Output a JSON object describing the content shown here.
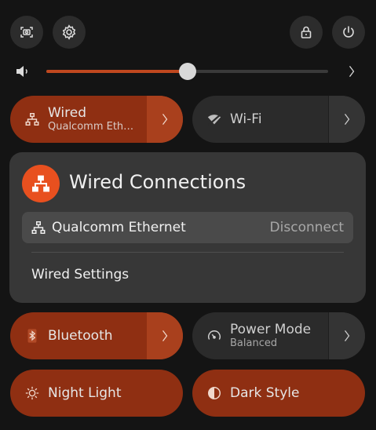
{
  "top_bar": {
    "screenshot_icon": "screenshot-icon",
    "settings_icon": "settings-gear-icon",
    "lock_icon": "lock-icon",
    "power_icon": "power-icon"
  },
  "volume": {
    "level": 0.5,
    "icon": "speaker-icon",
    "arrow": "chevron-right-icon"
  },
  "toggles": {
    "wired": {
      "title": "Wired",
      "subtitle": "Qualcomm Eth…",
      "active": true
    },
    "wifi": {
      "title": "Wi-Fi",
      "active": false
    },
    "bluetooth": {
      "title": "Bluetooth",
      "active": true
    },
    "power_mode": {
      "title": "Power Mode",
      "subtitle": "Balanced",
      "active": false
    },
    "night_light": {
      "title": "Night Light",
      "active": true
    },
    "dark_style": {
      "title": "Dark Style",
      "active": true
    }
  },
  "wired_menu": {
    "title": "Wired Connections",
    "connection_name": "Qualcomm Ethernet",
    "connection_action": "Disconnect",
    "settings_label": "Wired Settings"
  },
  "colors": {
    "accent": "#e8501f",
    "active_toggle": "#8f2f12",
    "inactive_toggle": "#2b2b2b",
    "background": "#141414"
  }
}
